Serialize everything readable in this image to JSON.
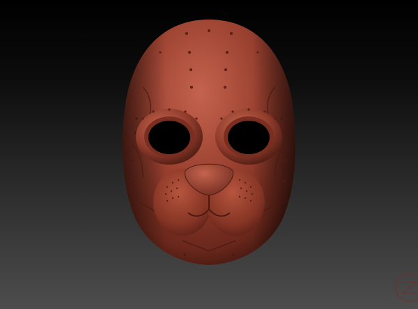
{
  "scene": {
    "subject": "mask-render",
    "colors": {
      "mask_base": "#8f3a2b",
      "mask_highlight": "#c4634e",
      "mask_shadow": "#4a1a12",
      "background_top": "#000000",
      "background_bottom": "#4d4d4d",
      "watermark": "#7a2a2a"
    },
    "icons": {
      "watermark": "zbrush-logo-icon"
    }
  }
}
